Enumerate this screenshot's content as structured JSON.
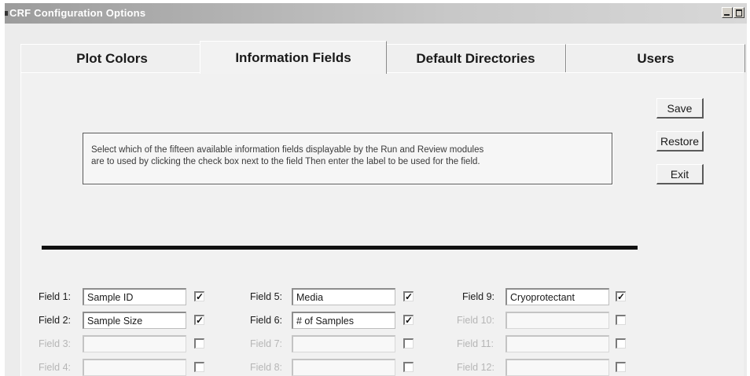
{
  "window": {
    "title": "CRF Configuration Options"
  },
  "tabs": [
    {
      "label": "Plot Colors",
      "active": false
    },
    {
      "label": "Information Fields",
      "active": true
    },
    {
      "label": "Default Directories",
      "active": false
    },
    {
      "label": "Users",
      "active": false
    }
  ],
  "instructions": {
    "line1": "Select which of the fifteen available information fields displayable by the Run and Review modules",
    "line2": "are to used by clicking the check box next to the field   Then enter the label to be used for the field."
  },
  "buttons": {
    "save": "Save",
    "restore": "Restore",
    "exit": "Exit"
  },
  "fields": [
    {
      "label": "Field 1:",
      "value": "Sample ID",
      "checked": true,
      "enabled": true
    },
    {
      "label": "Field 2:",
      "value": "Sample Size",
      "checked": true,
      "enabled": true
    },
    {
      "label": "Field 3:",
      "value": "",
      "checked": false,
      "enabled": false
    },
    {
      "label": "Field 4:",
      "value": "",
      "checked": false,
      "enabled": false
    },
    {
      "label": "Field 5:",
      "value": "Media",
      "checked": true,
      "enabled": true
    },
    {
      "label": "Field 6:",
      "value": "# of Samples",
      "checked": true,
      "enabled": true
    },
    {
      "label": "Field 7:",
      "value": "",
      "checked": false,
      "enabled": false
    },
    {
      "label": "Field 8:",
      "value": "",
      "checked": false,
      "enabled": false
    },
    {
      "label": "Field 9:",
      "value": "Cryoprotectant",
      "checked": true,
      "enabled": true
    },
    {
      "label": "Field 10:",
      "value": "",
      "checked": false,
      "enabled": false
    },
    {
      "label": "Field 11:",
      "value": "",
      "checked": false,
      "enabled": false
    },
    {
      "label": "Field 12:",
      "value": "",
      "checked": false,
      "enabled": false
    }
  ],
  "icons": {
    "checkbox_checked": "checkmark-icon",
    "minimize": "minimize-icon",
    "maximize": "maximize-icon",
    "system_menu": "system-menu-icon"
  },
  "colors": {
    "title_bar_start": "#9c9c9c",
    "title_bar_end": "#d8d8d8",
    "panel_background": "#f1f1f1",
    "divider": "#111111",
    "disabled_text": "#b6b6b6"
  }
}
